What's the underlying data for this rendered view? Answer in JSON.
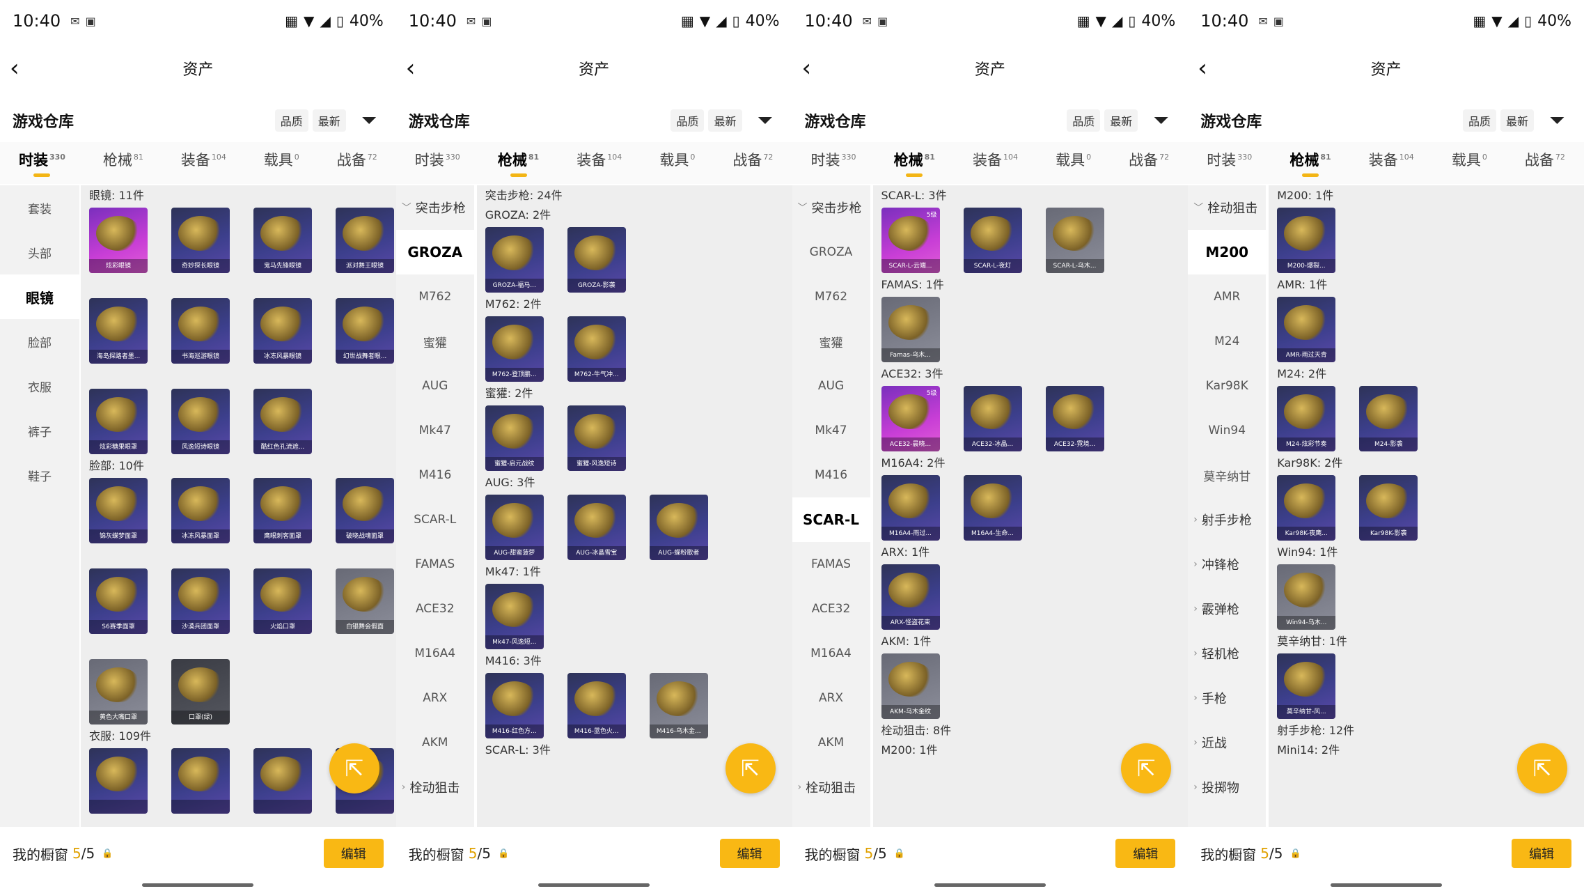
{
  "screens": [
    {
      "status": {
        "time": "10:40",
        "battery": "40%"
      },
      "title": "资产",
      "warehouse_label": "游戏仓库",
      "sort": [
        "品质",
        "最新"
      ],
      "tabs": [
        {
          "label": "时装",
          "count": "330",
          "active": true
        },
        {
          "label": "枪械",
          "count": "81",
          "active": false
        },
        {
          "label": "装备",
          "count": "104",
          "active": false
        },
        {
          "label": "载具",
          "count": "0",
          "active": false
        },
        {
          "label": "战备",
          "count": "72",
          "active": false
        }
      ],
      "side_style": "narrow",
      "side": [
        {
          "label": "套装"
        },
        {
          "label": "头部"
        },
        {
          "label": "眼镜",
          "active": true
        },
        {
          "label": "脸部"
        },
        {
          "label": "衣服"
        },
        {
          "label": "裤子"
        },
        {
          "label": "鞋子"
        }
      ],
      "sections": [
        {
          "title": "眼镜: 11件",
          "items": [
            {
              "name": "炫彩眼镜",
              "style": "purple"
            },
            {
              "name": "奇妙探长眼镜"
            },
            {
              "name": "鬼马先锋眼镜"
            },
            {
              "name": "派对舞王眼镜"
            },
            {
              "name": "海岛探路者墨..."
            },
            {
              "name": "书海巡游眼镜"
            },
            {
              "name": "冰冻风暴眼镜"
            },
            {
              "name": "幻世战舞者眼..."
            },
            {
              "name": "炫彩糖果眼罩"
            },
            {
              "name": "风逸短诗眼镜"
            },
            {
              "name": "酷红色孔流遮..."
            }
          ]
        },
        {
          "title": "脸部: 10件",
          "items": [
            {
              "name": "锦灰蝶梦面罩"
            },
            {
              "name": "冰冻风暴面罩"
            },
            {
              "name": "鹰眼刺客面罩"
            },
            {
              "name": "破晓战魂面罩"
            },
            {
              "name": "S6赛季面罩"
            },
            {
              "name": "沙漠兵团面罩"
            },
            {
              "name": "火焰口罩"
            },
            {
              "name": "白银舞会假面",
              "style": "gray"
            },
            {
              "name": "黄色大嘴口罩",
              "style": "gray"
            },
            {
              "name": "口罩(绿)",
              "style": "dark"
            }
          ]
        },
        {
          "title": "衣服: 109件",
          "items": [
            {
              "name": ""
            },
            {
              "name": ""
            },
            {
              "name": ""
            },
            {
              "name": ""
            }
          ]
        }
      ]
    },
    {
      "status": {
        "time": "10:40",
        "battery": "40%"
      },
      "title": "资产",
      "warehouse_label": "游戏仓库",
      "sort": [
        "品质",
        "最新"
      ],
      "tabs": [
        {
          "label": "时装",
          "count": "330",
          "active": false
        },
        {
          "label": "枪械",
          "count": "81",
          "active": true
        },
        {
          "label": "装备",
          "count": "104",
          "active": false
        },
        {
          "label": "载具",
          "count": "0",
          "active": false
        },
        {
          "label": "战备",
          "count": "72",
          "active": false
        }
      ],
      "side_style": "wide",
      "side": [
        {
          "label": "突击步枪",
          "cat": true,
          "arrow": "﹀"
        },
        {
          "label": "GROZA",
          "active": true
        },
        {
          "label": "M762"
        },
        {
          "label": "蜜獾"
        },
        {
          "label": "AUG"
        },
        {
          "label": "Mk47"
        },
        {
          "label": "M416"
        },
        {
          "label": "SCAR-L"
        },
        {
          "label": "FAMAS"
        },
        {
          "label": "ACE32"
        },
        {
          "label": "M16A4"
        },
        {
          "label": "ARX"
        },
        {
          "label": "AKM"
        },
        {
          "label": "栓动狙击",
          "cat": true,
          "arrow": "›"
        }
      ],
      "sections": [
        {
          "title": "突击步枪: 24件",
          "items": []
        },
        {
          "title": "GROZA: 2件",
          "items": [
            {
              "name": "GROZA-福马..."
            },
            {
              "name": "GROZA-影袭"
            }
          ]
        },
        {
          "title": "M762: 2件",
          "items": [
            {
              "name": "M762-登顶鹏..."
            },
            {
              "name": "M762-牛气冲..."
            }
          ]
        },
        {
          "title": "蜜獾: 2件",
          "items": [
            {
              "name": "蜜獾-启元战纹"
            },
            {
              "name": "蜜獾-风逸短诗"
            }
          ]
        },
        {
          "title": "AUG: 3件",
          "items": [
            {
              "name": "AUG-甜蜜菠萝"
            },
            {
              "name": "AUG-冰晶雪宝"
            },
            {
              "name": "AUG-蝶粉歌者"
            }
          ]
        },
        {
          "title": "Mk47: 1件",
          "items": [
            {
              "name": "Mk47-风逸短..."
            }
          ]
        },
        {
          "title": "M416: 3件",
          "items": [
            {
              "name": "M416-红色方..."
            },
            {
              "name": "M416-蓝色火..."
            },
            {
              "name": "M416-乌木金...",
              "style": "gray"
            }
          ]
        },
        {
          "title": "SCAR-L: 3件",
          "items": []
        }
      ]
    },
    {
      "status": {
        "time": "10:40",
        "battery": "40%"
      },
      "title": "资产",
      "warehouse_label": "游戏仓库",
      "sort": [
        "品质",
        "最新"
      ],
      "tabs": [
        {
          "label": "时装",
          "count": "330",
          "active": false
        },
        {
          "label": "枪械",
          "count": "81",
          "active": true
        },
        {
          "label": "装备",
          "count": "104",
          "active": false
        },
        {
          "label": "载具",
          "count": "0",
          "active": false
        },
        {
          "label": "战备",
          "count": "72",
          "active": false
        }
      ],
      "side_style": "wide",
      "side": [
        {
          "label": "突击步枪",
          "cat": true,
          "arrow": "﹀"
        },
        {
          "label": "GROZA"
        },
        {
          "label": "M762"
        },
        {
          "label": "蜜獾"
        },
        {
          "label": "AUG"
        },
        {
          "label": "Mk47"
        },
        {
          "label": "M416"
        },
        {
          "label": "SCAR-L",
          "active": true
        },
        {
          "label": "FAMAS"
        },
        {
          "label": "ACE32"
        },
        {
          "label": "M16A4"
        },
        {
          "label": "ARX"
        },
        {
          "label": "AKM"
        },
        {
          "label": "栓动狙击",
          "cat": true,
          "arrow": "›"
        }
      ],
      "sections": [
        {
          "title": "SCAR-L: 3件",
          "items": [
            {
              "name": "SCAR-L-云端...",
              "style": "purple",
              "rank": "5级"
            },
            {
              "name": "SCAR-L-夜灯"
            },
            {
              "name": "SCAR-L-乌木...",
              "style": "gray"
            }
          ]
        },
        {
          "title": "FAMAS: 1件",
          "items": [
            {
              "name": "Famas-乌木...",
              "style": "gray"
            }
          ]
        },
        {
          "title": "ACE32: 3件",
          "items": [
            {
              "name": "ACE32-晨晓...",
              "style": "purple",
              "rank": "5级"
            },
            {
              "name": "ACE32-冰晶..."
            },
            {
              "name": "ACE32-霓境..."
            }
          ]
        },
        {
          "title": "M16A4: 2件",
          "items": [
            {
              "name": "M16A4-雨过..."
            },
            {
              "name": "M16A4-生命..."
            }
          ]
        },
        {
          "title": "ARX: 1件",
          "items": [
            {
              "name": "ARX-怪盗花束"
            }
          ]
        },
        {
          "title": "AKM: 1件",
          "items": [
            {
              "name": "AKM-乌木金纹",
              "style": "gray"
            }
          ]
        },
        {
          "title": "栓动狙击: 8件",
          "items": []
        },
        {
          "title": "M200: 1件",
          "items": []
        }
      ]
    },
    {
      "status": {
        "time": "10:40",
        "battery": "40%"
      },
      "title": "资产",
      "warehouse_label": "游戏仓库",
      "sort": [
        "品质",
        "最新"
      ],
      "tabs": [
        {
          "label": "时装",
          "count": "330",
          "active": false
        },
        {
          "label": "枪械",
          "count": "81",
          "active": true
        },
        {
          "label": "装备",
          "count": "104",
          "active": false
        },
        {
          "label": "载具",
          "count": "0",
          "active": false
        },
        {
          "label": "战备",
          "count": "72",
          "active": false
        }
      ],
      "side_style": "wide",
      "side": [
        {
          "label": "栓动狙击",
          "cat": true,
          "arrow": "﹀"
        },
        {
          "label": "M200",
          "active": true
        },
        {
          "label": "AMR"
        },
        {
          "label": "M24"
        },
        {
          "label": "Kar98K"
        },
        {
          "label": "Win94"
        },
        {
          "label": "莫辛纳甘"
        },
        {
          "label": "射手步枪",
          "cat": true,
          "arrow": "›"
        },
        {
          "label": "冲锋枪",
          "cat": true,
          "arrow": "›"
        },
        {
          "label": "霰弹枪",
          "cat": true,
          "arrow": "›"
        },
        {
          "label": "轻机枪",
          "cat": true,
          "arrow": "›"
        },
        {
          "label": "手枪",
          "cat": true,
          "arrow": "›"
        },
        {
          "label": "近战",
          "cat": true,
          "arrow": "›"
        },
        {
          "label": "投掷物",
          "cat": true,
          "arrow": "›"
        }
      ],
      "sections": [
        {
          "title": "M200: 1件",
          "items": [
            {
              "name": "M200-爆裂..."
            }
          ]
        },
        {
          "title": "AMR: 1件",
          "items": [
            {
              "name": "AMR-雨过天青"
            }
          ]
        },
        {
          "title": "M24: 2件",
          "items": [
            {
              "name": "M24-炫彩节奏"
            },
            {
              "name": "M24-影袭"
            }
          ]
        },
        {
          "title": "Kar98K: 2件",
          "items": [
            {
              "name": "Kar98K-夜鹰..."
            },
            {
              "name": "Kar98K-影袭"
            }
          ]
        },
        {
          "title": "Win94: 1件",
          "items": [
            {
              "name": "Win94-乌木...",
              "style": "gray"
            }
          ]
        },
        {
          "title": "莫辛纳甘: 1件",
          "items": [
            {
              "name": "莫辛纳甘-风..."
            }
          ]
        },
        {
          "title": "射手步枪: 12件",
          "items": []
        },
        {
          "title": "Mini14: 2件",
          "items": []
        }
      ]
    }
  ],
  "bottom": {
    "label": "我的橱窗",
    "count_used": "5",
    "count_total": "/5",
    "edit_label": "编辑"
  },
  "icons": {
    "back": "chevron-left-icon",
    "filter": "filter-icon",
    "fab": "share-icon",
    "lock": "lock-icon"
  }
}
